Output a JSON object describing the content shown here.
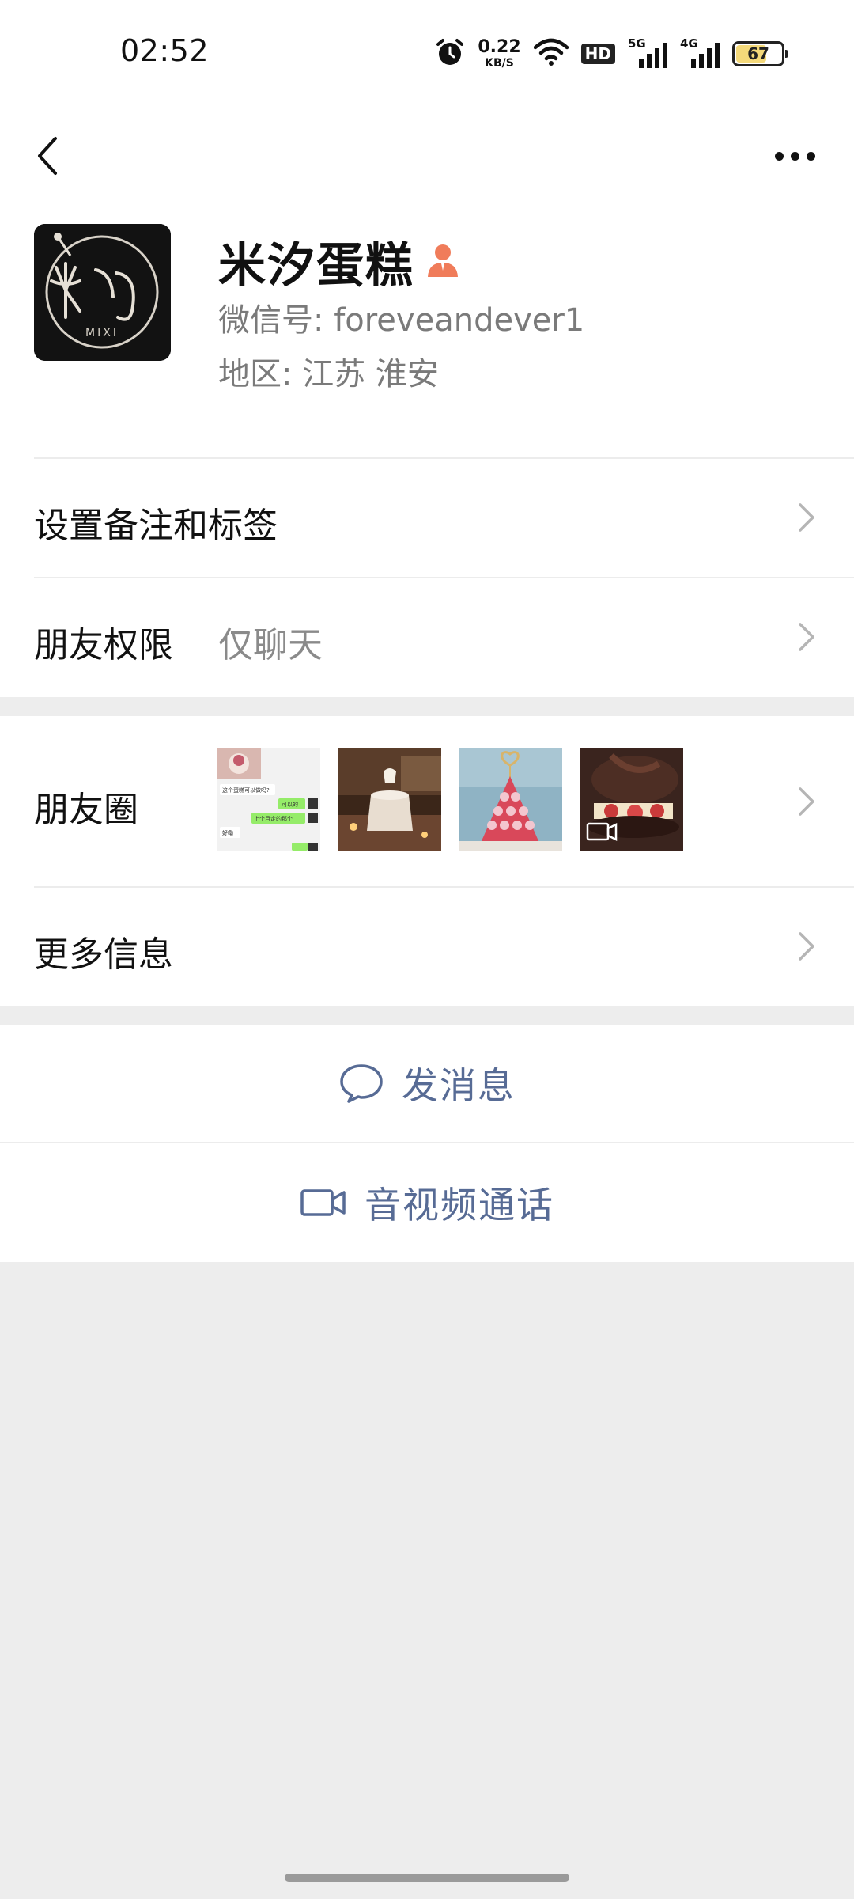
{
  "status_bar": {
    "time": "02:52",
    "net_speed_value": "0.22",
    "net_speed_unit": "KB/S",
    "hd_label": "HD",
    "sim1_label": "5G",
    "sim2_label": "4G",
    "battery_level": "67",
    "battery_fill_fraction": 0.67,
    "battery_fill_color": "#f4d97a"
  },
  "nav": {
    "back_icon": "chevron-left-icon",
    "more_icon": "more-dots-icon"
  },
  "profile": {
    "name": "米汐蛋糕",
    "badge_icon": "enterprise-person-icon",
    "badge_color": "#f07c5a",
    "wechat_id": "微信号: foreveandever1",
    "region": "地区: 江苏  淮安",
    "avatar_text": "MIXI"
  },
  "cells": {
    "remark": {
      "label": "设置备注和标签"
    },
    "permission": {
      "label": "朋友权限",
      "value": "仅聊天"
    },
    "moments": {
      "label": "朋友圈",
      "thumb_chat_lines": [
        "这个蛋糕可以做吗?",
        "可以的",
        "上个月定的那个",
        "好嘞"
      ]
    },
    "more_info": {
      "label": "更多信息"
    }
  },
  "actions": {
    "message": {
      "label": "发消息",
      "icon": "chat-bubble-icon"
    },
    "call": {
      "label": "音视频通话",
      "icon": "video-camera-icon"
    },
    "accent_color": "#576b95"
  }
}
